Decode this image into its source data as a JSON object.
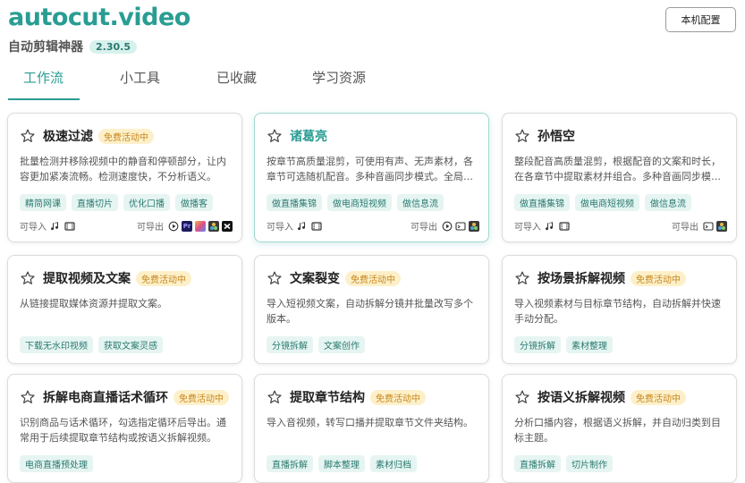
{
  "brand": "autocut.video",
  "app": {
    "subtitle": "自动剪辑神器",
    "version": "2.30.5"
  },
  "header": {
    "config_button": "本机配置"
  },
  "tabs": [
    {
      "label": "工作流",
      "active": true
    },
    {
      "label": "小工具",
      "active": false
    },
    {
      "label": "已收藏",
      "active": false
    },
    {
      "label": "学习资源",
      "active": false
    }
  ],
  "colors": {
    "accent": "#2a9d93",
    "promo_bg": "#fdf0c9",
    "promo_text": "#c7861f",
    "tag_bg": "#e6f5f2"
  },
  "cards": [
    {
      "title": "极速过滤",
      "promo": "免费活动中",
      "desc": "批量检测并移除视频中的静音和停顿部分，让内容更加紧凑流畅。检测速度快，不分析语义。",
      "tags": [
        "精简网课",
        "直播切片",
        "优化口播",
        "做播客"
      ],
      "import_label": "可导入",
      "import_icons": [
        "audio-icon",
        "video-icon"
      ],
      "export_label": "可导出",
      "export_icons": [
        "play-icon",
        "premiere-icon",
        "finalcut-icon",
        "davinci-icon",
        "capcut-icon"
      ]
    },
    {
      "title": "诸葛亮",
      "promo": "",
      "desc": "按章节高质量混剪，可使用有声、无声素材，各章节可选随机配音。多种音画同步模式。全局…",
      "tags": [
        "做直播集锦",
        "做电商短视频",
        "做信息流"
      ],
      "import_label": "可导入",
      "import_icons": [
        "audio-icon",
        "video-icon"
      ],
      "export_label": "可导出",
      "export_icons": [
        "play-icon",
        "subtitle-icon",
        "davinci-icon"
      ]
    },
    {
      "title": "孙悟空",
      "promo": "",
      "desc": "整段配音高质量混剪，根据配音的文案和时长，在各章节中提取素材并组合。多种音画同步模…",
      "tags": [
        "做直播集锦",
        "做电商短视频",
        "做信息流"
      ],
      "import_label": "可导入",
      "import_icons": [
        "audio-icon",
        "video-icon"
      ],
      "export_label": "可导出",
      "export_icons": [
        "subtitle-icon",
        "davinci-icon"
      ]
    },
    {
      "title": "提取视频及文案",
      "promo": "免费活动中",
      "desc": "从链接提取媒体资源并提取文案。",
      "tags": [
        "下载无水印视频",
        "获取文案灵感"
      ]
    },
    {
      "title": "文案裂变",
      "promo": "免费活动中",
      "desc": "导入短视频文案，自动拆解分镜并批量改写多个版本。",
      "tags": [
        "分镜拆解",
        "文案创作"
      ]
    },
    {
      "title": "按场景拆解视频",
      "promo": "免费活动中",
      "desc": "导入视频素材与目标章节结构，自动拆解并快速手动分配。",
      "tags": [
        "分镜拆解",
        "素材整理"
      ]
    },
    {
      "title": "拆解电商直播话术循环",
      "promo": "免费活动中",
      "desc": "识别商品与话术循环，勾选指定循环后导出。通常用于后续提取章节结构或按语义拆解视频。",
      "tags": [
        "电商直播预处理"
      ]
    },
    {
      "title": "提取章节结构",
      "promo": "免费活动中",
      "desc": "导入音视频，转写口播并提取章节文件夹结构。",
      "tags": [
        "直播拆解",
        "脚本整理",
        "素材归档"
      ]
    },
    {
      "title": "按语义拆解视频",
      "promo": "免费活动中",
      "desc": "分析口播内容，根据语义拆解，并自动归类到目标主题。",
      "tags": [
        "直播拆解",
        "切片制作"
      ]
    }
  ]
}
